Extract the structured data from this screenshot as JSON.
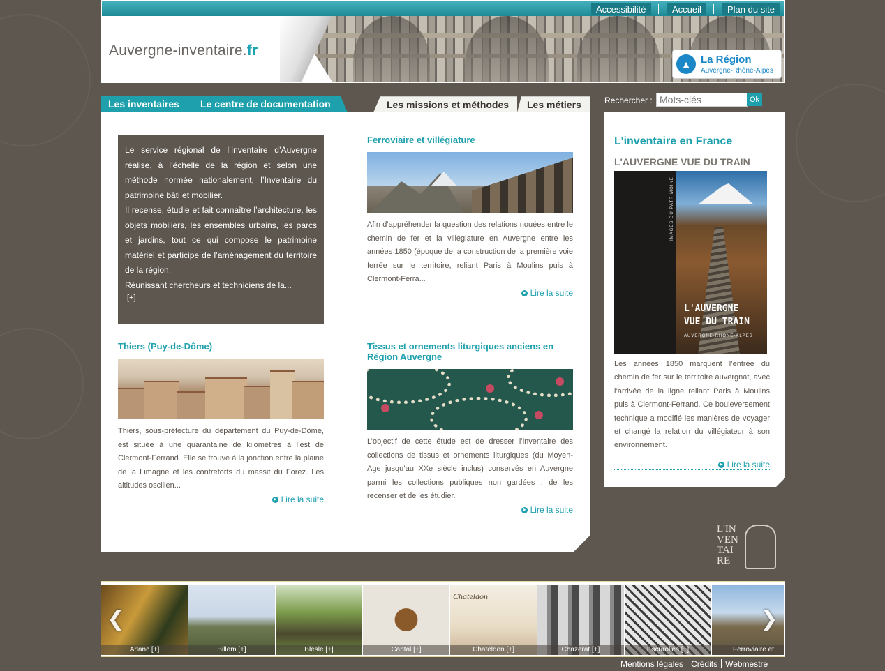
{
  "header": {
    "links": [
      "Accessibilité",
      "Accueil",
      "Plan du site"
    ],
    "logo_main": "Auvergne-inventaire.",
    "logo_tld": "fr",
    "region_logo_title": "La Région",
    "region_logo_subtitle": "Auvergne-Rhône-Alpes"
  },
  "nav": {
    "tabs": [
      "Les inventaires",
      "Le centre de documentation",
      "Les missions et méthodes",
      "Les métiers"
    ]
  },
  "search": {
    "label": "Rechercher :",
    "placeholder": "Mots-clés",
    "button": "Ok"
  },
  "intro": {
    "paragraphs": [
      "Le service régional de l’Inventaire d’Auvergne réalise, à l’échelle de la région et selon une méthode normée nationalement, l’Inventaire du patrimoine bâti et mobilier.",
      "Il recense, étudie et fait connaître l’architecture, les objets mobiliers, les ensembles urbains, les parcs et jardins, tout ce qui compose le patrimoine matériel et participe de l’aménagement du territoire de la région.",
      "Réunissant chercheurs et techniciens de la..."
    ],
    "more": "[+]"
  },
  "articles": [
    {
      "title": "Ferroviaire et villégiature",
      "text": "Afin d’appréhender la question des relations nouées entre le chemin de fer et la villégiature en Auvergne entre les années 1850 (époque de la construction de la première voie ferrée sur le territoire, reliant Paris à Moulins puis à Clermont-Ferra...",
      "read_more": "Lire la suite"
    },
    {
      "title": "Thiers (Puy-de-Dôme)",
      "text": "Thiers, sous-préfecture du département du Puy-de-Dôme, est située à une quarantaine de kilomètres à l’est de Clermont-Ferrand. Elle se trouve à la jonction entre la plaine de la Limagne et les contreforts du massif du Forez. Les altitudes oscillen...",
      "read_more": "Lire la suite"
    },
    {
      "title": "Tissus et ornements liturgiques anciens en Région Auvergne",
      "text": "L’objectif de cette étude est de dresser l’inventaire des collections de tissus et ornements liturgiques (du Moyen-Age jusqu’au XXe siècle inclus) conservés en Auvergne parmi les collections publiques non gardées : de les recenser et de les étudier.",
      "read_more": "Lire la suite"
    }
  ],
  "sidebar": {
    "heading": "L'inventaire en France",
    "subheading": "L'AUVERGNE VUE DU TRAIN",
    "book_vertical_text": "IMAGES DU PATRIMOINE",
    "book_title_line1": "L'AUVERGNE",
    "book_title_line2": "VUE DU TRAIN",
    "book_subtitle": "AUVERGNE-RHÔNE-ALPES",
    "text": "Les années 1850 marquent l’entrée du chemin de fer sur le territoire auvergnat, avec l’arrivée de la ligne reliant Paris à Moulins puis à Clermont-Ferrand. Ce bouleversement technique a modifié les manières de voyager et changé la relation du villégiateur à son environnement.",
    "read_more": "Lire la suite"
  },
  "emblem": {
    "lines": [
      "L'IN",
      "VEN",
      "TAI",
      "RE"
    ]
  },
  "carousel": {
    "items": [
      "Arlanc [+]",
      "Billom [+]",
      "Blesle [+]",
      "Cantal [+]",
      "Chateldon [+]",
      "Chazerat [+]",
      "Escurolles [+]",
      "Ferroviaire et"
    ],
    "chateldon_script": "Chateldon"
  },
  "footer": {
    "links": [
      "Mentions légales",
      "Crédits",
      "Webmestre"
    ]
  },
  "colors": {
    "teal": "#1ea0ad",
    "background": "#5e574f",
    "intro_box": "#5e574f"
  }
}
